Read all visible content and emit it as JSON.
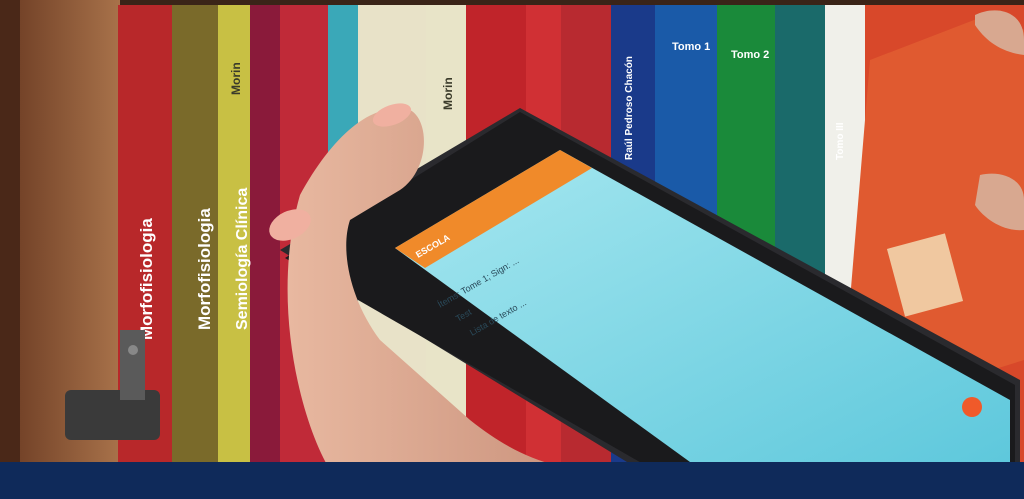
{
  "photo": {
    "caption_bar_color": "#0f2a5a",
    "scene_colors": {
      "shelf_wood": "#8a5a3a",
      "app_header": "#f08a2a",
      "app_body": "#8fdbe8",
      "fab": "#f05a2a"
    }
  },
  "books": [
    {
      "title": "Morfofisiologia",
      "color": "#b8282a"
    },
    {
      "title": "Morfofisiologia",
      "color": "#7a6a2a"
    },
    {
      "title": "Morin",
      "color": "#c8c044"
    },
    {
      "title": "Semiología Clínica",
      "color": "#8a1a3a"
    },
    {
      "title": "Morin",
      "color": "#e8e4c8"
    },
    {
      "title": "Raúl Pedroso Chacón",
      "color": "#1a3a8a"
    },
    {
      "title": "Tomo 1",
      "color": "#1a5aa8"
    },
    {
      "title": "Tomo 2",
      "color": "#1a8a3a"
    },
    {
      "title": "Tomo III",
      "color": "#1a6a6a"
    }
  ],
  "tablet_app": {
    "header_text": "ESCOLA",
    "list_lines": [
      "Ítems: Tome 1; Sign: ...",
      "Test",
      "Lista de texto ..."
    ]
  }
}
